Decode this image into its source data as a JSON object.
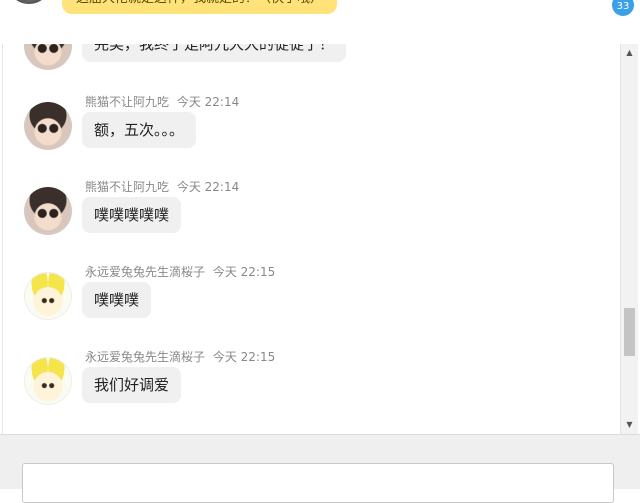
{
  "top": {
    "partial_message": "这届大佬就是这样，我就是的？（快了哦）",
    "unread_badge": "33"
  },
  "messages": [
    {
      "user": "",
      "time": "",
      "avatar": "panda-avatar",
      "text": "完美，我终于是阿九大大的徒徒了！"
    },
    {
      "user": "熊猫不让阿九吃",
      "time": "今天 22:14",
      "avatar": "panda-avatar",
      "text": "额，五次。。。"
    },
    {
      "user": "熊猫不让阿九吃",
      "time": "今天 22:14",
      "avatar": "panda-avatar",
      "text": "噗噗噗噗噗"
    },
    {
      "user": "永远爱兔兔先生滴桜子",
      "time": "今天 22:15",
      "avatar": "bunny-avatar",
      "text": "噗噗噗"
    },
    {
      "user": "永远爱兔兔先生滴桜子",
      "time": "今天 22:15",
      "avatar": "bunny-avatar",
      "text": "我们好调爱"
    }
  ],
  "scrollbar": {
    "up_icon": "▲",
    "down_icon": "▼"
  },
  "input": {
    "placeholder": ""
  }
}
